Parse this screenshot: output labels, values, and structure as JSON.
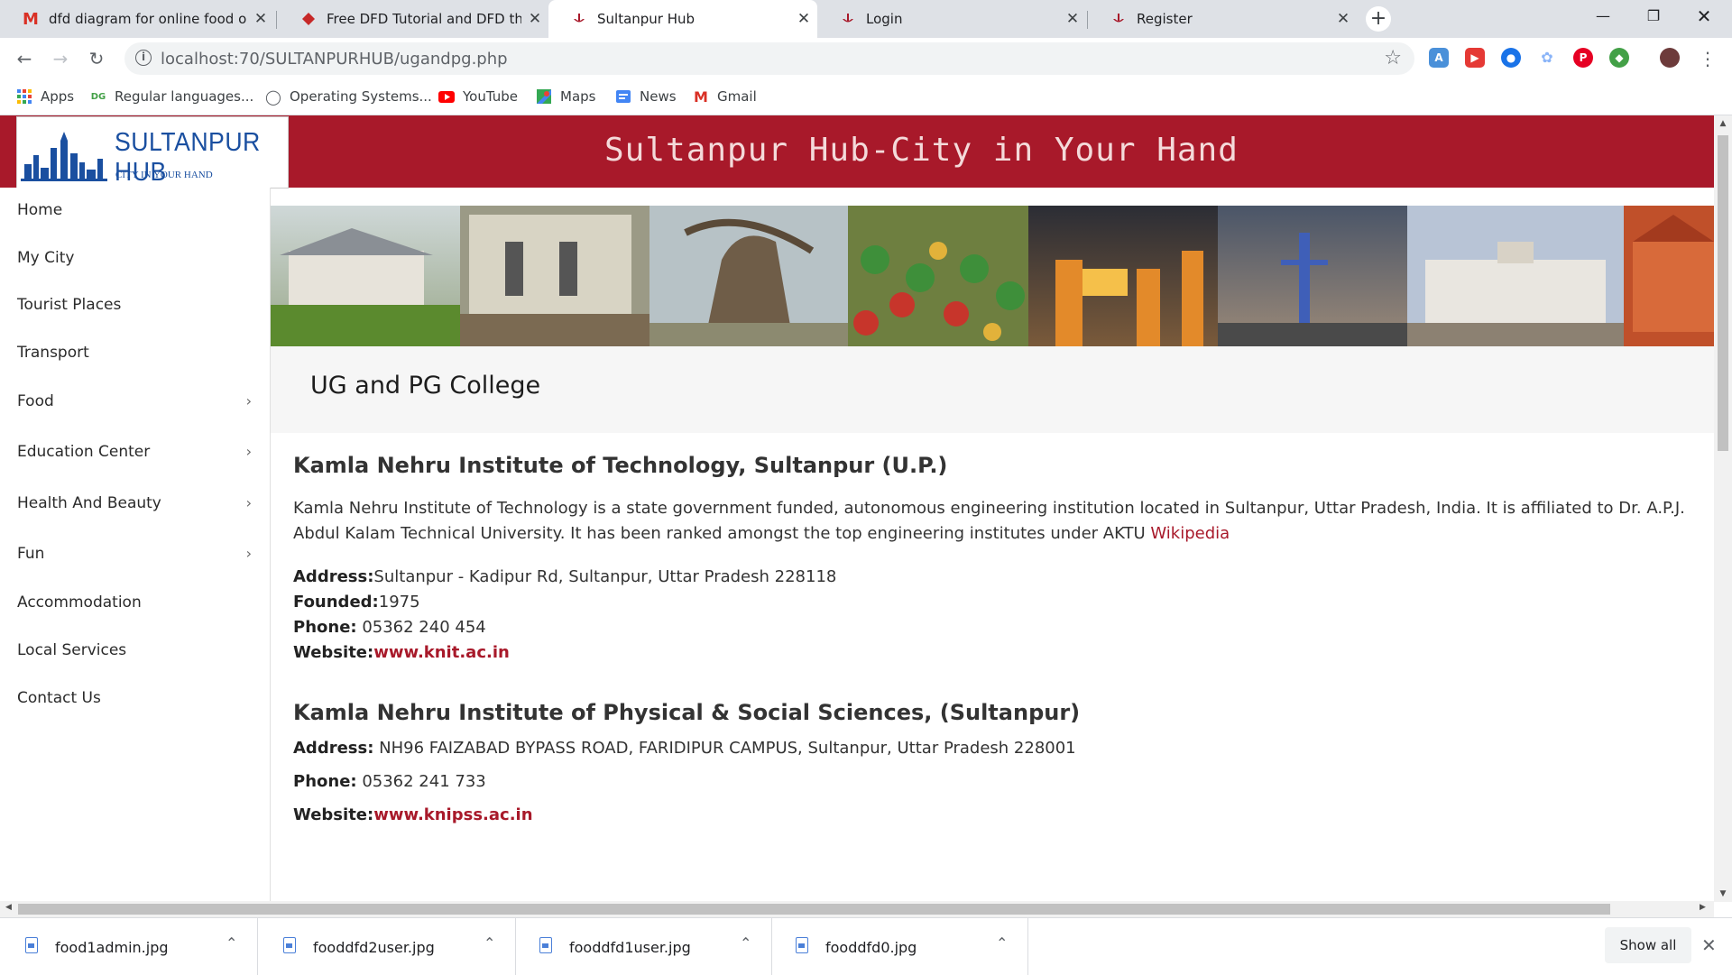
{
  "browser": {
    "tabs": [
      {
        "title": "dfd diagram for online food orde",
        "icon": "gmail-icon",
        "close": "✕"
      },
      {
        "title": "Free DFD Tutorial and DFD the be",
        "icon": "diagram-site-icon",
        "close": "✕"
      },
      {
        "title": "Sultanpur Hub",
        "icon": "local-site-icon",
        "close": "✕"
      },
      {
        "title": "Login",
        "icon": "local-site-icon",
        "close": "✕"
      },
      {
        "title": "Register",
        "icon": "local-site-icon",
        "close": "✕"
      }
    ],
    "new_tab": "+",
    "url": "localhost:70/SULTANPURHUB/ugandpg.php",
    "bookmarks": [
      {
        "label": "Apps",
        "icon": "apps-grid-icon"
      },
      {
        "label": "Regular languages...",
        "icon": "dg-icon"
      },
      {
        "label": "Operating Systems...",
        "icon": "globe-icon"
      },
      {
        "label": "YouTube",
        "icon": "youtube-icon"
      },
      {
        "label": "Maps",
        "icon": "maps-icon"
      },
      {
        "label": "News",
        "icon": "news-icon"
      },
      {
        "label": "Gmail",
        "icon": "gmail-icon"
      }
    ]
  },
  "site": {
    "brand": "SULTANPUR HUB",
    "tagline": "CITY IN YOUR HAND",
    "header_title": "Sultanpur Hub-City in Your Hand",
    "menu": [
      {
        "label": "Home",
        "has_submenu": false
      },
      {
        "label": "My City",
        "has_submenu": false
      },
      {
        "label": "Tourist Places",
        "has_submenu": false
      },
      {
        "label": "Transport",
        "has_submenu": false
      },
      {
        "label": "Food",
        "has_submenu": true
      },
      {
        "label": "Education Center",
        "has_submenu": true
      },
      {
        "label": "Health And Beauty",
        "has_submenu": true
      },
      {
        "label": "Fun",
        "has_submenu": true
      },
      {
        "label": "Accommodation",
        "has_submenu": false
      },
      {
        "label": "Local Services",
        "has_submenu": false
      },
      {
        "label": "Contact Us",
        "has_submenu": false
      }
    ],
    "page_title": "UG and PG College",
    "college1": {
      "name": "Kamla Nehru Institute of Technology, Sultanpur (U.P.)",
      "description": "Kamla Nehru Institute of Technology is a state government funded, autonomous engineering institution located in Sultanpur, Uttar Pradesh, India. It is affiliated to Dr. A.P.J. Abdul Kalam Technical University. It has been ranked amongst the top engineering institutes under AKTU",
      "wiki_link": "Wikipedia",
      "address_label": "Address:",
      "address": "Sultanpur - Kadipur Rd, Sultanpur, Uttar Pradesh 228118",
      "founded_label": "Founded:",
      "founded": "1975",
      "phone_label": "Phone:",
      "phone": "05362 240 454",
      "website_label": "Website:",
      "website": "www.knit.ac.in"
    },
    "college2": {
      "name": "Kamla Nehru Institute of Physical & Social Sciences, (Sultanpur)",
      "address_label": "Address:",
      "address": "NH96 FAIZABAD BYPASS ROAD, FARIDIPUR CAMPUS, Sultanpur, Uttar Pradesh 228001",
      "phone_label": "Phone:",
      "phone": "05362 241 733",
      "website_label": "Website:",
      "website": "www.knipss.ac.in"
    }
  },
  "downloads": {
    "files": [
      "food1admin.jpg",
      "fooddfd2user.jpg",
      "fooddfd1user.jpg",
      "fooddfd0.jpg"
    ],
    "show_all": "Show all"
  },
  "colors": {
    "accent": "#a8192a",
    "brand_blue": "#1a4fa0"
  }
}
